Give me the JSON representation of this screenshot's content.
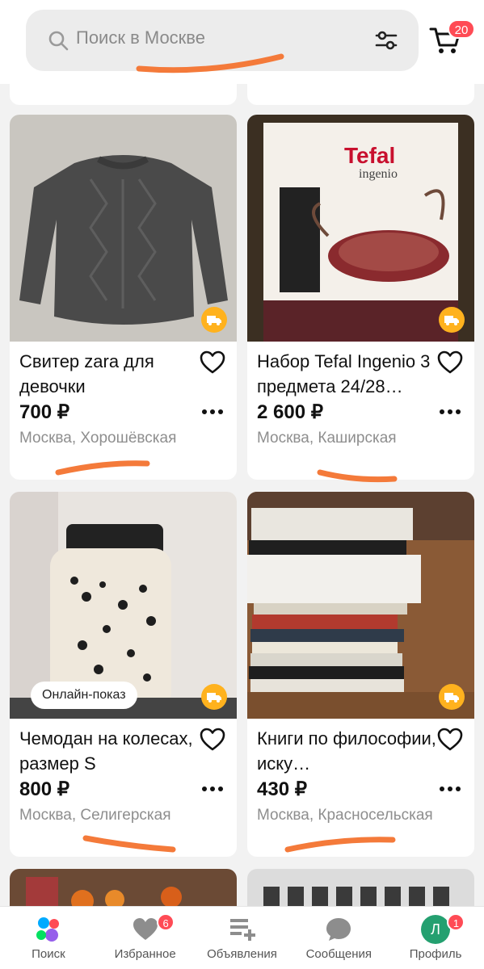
{
  "search": {
    "placeholder": "Поиск в Москве"
  },
  "cart": {
    "count": "20"
  },
  "listings": [
    {
      "title": "Свитер zara для девочки",
      "price": "700 ₽",
      "location": "Москва, Хорошёвская",
      "delivery": true
    },
    {
      "title": "Набор Tefal Ingenio 3 предмета 24/28…",
      "price": "2 600 ₽",
      "location": "Москва, Каширская",
      "delivery": true
    },
    {
      "title": "Чемодан на колесах, размер S",
      "price": "800 ₽",
      "location": "Москва, Селигерская",
      "badge": "Онлайн-показ",
      "delivery": true
    },
    {
      "title": "Книги по философии, иску…",
      "price": "430 ₽",
      "location": "Москва, Красносельская",
      "delivery": true
    }
  ],
  "nav": {
    "items": [
      {
        "label": "Поиск",
        "icon": "search-dots-icon"
      },
      {
        "label": "Избранное",
        "icon": "heart-icon",
        "badge": "6"
      },
      {
        "label": "Объявления",
        "icon": "ads-icon"
      },
      {
        "label": "Сообщения",
        "icon": "chat-icon"
      },
      {
        "label": "Профиль",
        "icon": "avatar-icon",
        "badge": "1",
        "avatar_letter": "Л"
      }
    ]
  },
  "colors": {
    "accent_red": "#ff4b55",
    "delivery_orange": "#ffb21e",
    "scribble": "#f47a3a",
    "text_gray": "#8e8e8e"
  }
}
